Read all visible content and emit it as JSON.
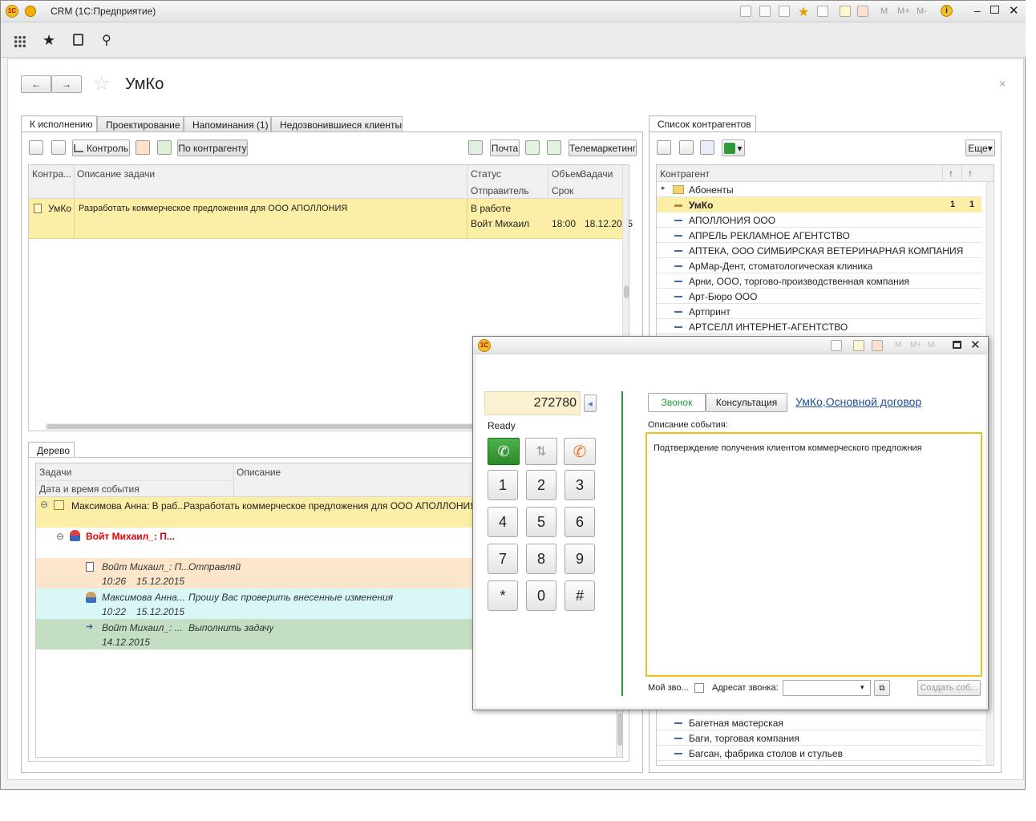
{
  "window": {
    "app_title": "CRM  (1С:Предприятие)",
    "logo_text": "1С"
  },
  "titlebar_tools": {
    "m": "M",
    "mplus": "M+",
    "mminus": "M-"
  },
  "page": {
    "title": "УмКо"
  },
  "left_tabs": [
    {
      "label": "К исполнению"
    },
    {
      "label": "Проектирование"
    },
    {
      "label": "Напоминания (1)"
    },
    {
      "label": "Недозвонившиеся клиенты"
    }
  ],
  "left_toolbar": {
    "control": "Контроль",
    "by_counterparty": "По контрагенту",
    "mail": "Почта",
    "telemarketing": "Телемаркетинг"
  },
  "tasks_table": {
    "headers": {
      "counterparty": "Контра...",
      "description": "Описание задачи",
      "status": "Статус",
      "volume": "Объем",
      "tasks": "Задачи",
      "sender": "Отправитель",
      "deadline": "Срок"
    },
    "row": {
      "counterparty": "УмКо",
      "description": "Разработать коммерческое предложения для ООО АПОЛЛОНИЯ",
      "status": "В работе",
      "sender": "Войт Михаил",
      "time": "18:00",
      "date": "18.12.2015"
    }
  },
  "tree_panel": {
    "tab": "Дерево",
    "headers": {
      "tasks": "Задачи",
      "description": "Описание",
      "datetime": "Дата и время события"
    },
    "rows": [
      {
        "who": "Максимова Анна: В раб...",
        "desc": "Разработать коммерческое предложения для ООО АПОЛЛОНИЯ"
      },
      {
        "who": "Войт Михаил_: П..."
      },
      {
        "who": "Войт Михаил_: П...",
        "desc": "Отправляй",
        "time": "10:26",
        "date": "15.12.2015"
      },
      {
        "who": "Максимова Анна...",
        "desc": "Прошу Вас проверить внесенные изменения",
        "time": "10:22",
        "date": "15.12.2015"
      },
      {
        "who": "Войт Михаил_: ...",
        "desc": "Выполнить задачу",
        "date": "14.12.2015"
      }
    ]
  },
  "right_panel": {
    "tab": "Список контрагентов",
    "more_button": "Еще",
    "header": {
      "counterparty": "Контрагент",
      "sort1": "↑",
      "sort2": "↑"
    },
    "folder": "Абоненты",
    "selected": {
      "name": "УмКо",
      "c1": "1",
      "c2": "1"
    },
    "items": [
      "АПОЛЛОНИЯ ООО",
      "АПРЕЛЬ РЕКЛАМНОЕ АГЕНТСТВО",
      "АПТЕКА, ООО СИМБИРСКАЯ ВЕТЕРИНАРНАЯ КОМПАНИЯ",
      "АрМар-Дент, стоматологическая клиника",
      "Арни, ООО, торгово-производственная компания",
      "Арт-Бюро ООО",
      "Артпринт",
      "АРТСЕЛЛ ИНТЕРНЕТ-АГЕНТСТВО"
    ],
    "bottom_items": [
      "Багетная мастерская",
      "Баги, торговая компания",
      "Багсан, фабрика столов и стульев"
    ]
  },
  "phone_window": {
    "number": "272780",
    "status": "Ready",
    "keys": [
      "1",
      "2",
      "3",
      "4",
      "5",
      "6",
      "7",
      "8",
      "9",
      "*",
      "0",
      "#"
    ],
    "tabs": {
      "call": "Звонок",
      "consult": "Консультация"
    },
    "contract_link": "УмКо,Основной договор",
    "event_label": "Описание события:",
    "event_text": "Подтверждение получения клиентом коммерческого предложния",
    "my_call_label": "Мой зво...",
    "addressee_label": "Адресат звонка:",
    "create_button": "Создать соб..."
  },
  "colors": {
    "selected_row": "#fbeea6",
    "green_row": "#c3dec3",
    "cyan_row": "#d9f7f7",
    "orange_row": "#fbe6cc",
    "link": "#1f4f9c",
    "accent_green": "#1f9a3f"
  }
}
